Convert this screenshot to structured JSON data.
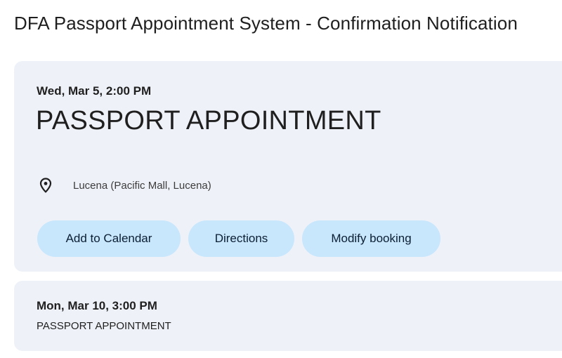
{
  "header": {
    "title": "DFA Passport Appointment System - Confirmation Notification"
  },
  "appointments": [
    {
      "datetime": "Wed, Mar 5, 2:00 PM",
      "title": "PASSPORT APPOINTMENT",
      "location": "Lucena (Pacific Mall, Lucena)",
      "location_icon": "location-pin-icon",
      "actions": {
        "add_to_calendar": "Add to Calendar",
        "directions": "Directions",
        "modify_booking": "Modify booking"
      }
    },
    {
      "datetime": "Mon, Mar 10, 3:00 PM",
      "title": "PASSPORT APPOINTMENT"
    }
  ],
  "colors": {
    "card_background": "#eef2f8",
    "button_background": "#c8e6fc",
    "text_primary": "#1f1f1f"
  }
}
